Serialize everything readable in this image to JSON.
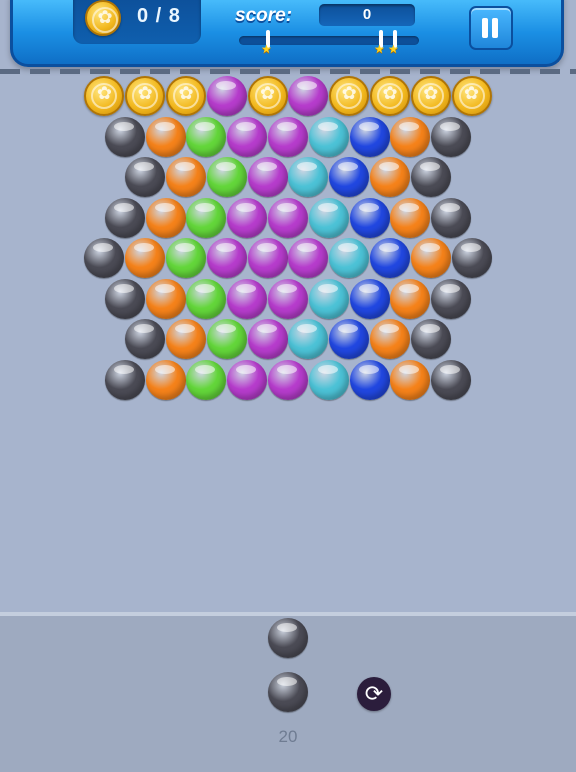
{
  "hud": {
    "coins_collected": "0 / 8",
    "score_label": "score:",
    "score_value": "0",
    "progress": 0,
    "star_markers": 3,
    "pause_icon": "pause-icon",
    "coin_icon": "gold-coin-icon"
  },
  "colors": {
    "G": "#4b4b55",
    "O": "#f5821a",
    "L": "#63d63a",
    "P": "#b63ccc",
    "C": "#4cc2d6",
    "B": "#2147e0",
    "Y": "coin"
  },
  "board": {
    "rows": [
      [
        "Y",
        "Y",
        "Y",
        "P",
        "Y",
        "P",
        "Y",
        "Y",
        "Y",
        "Y"
      ],
      [
        "G",
        "O",
        "L",
        "P",
        "P",
        "C",
        "B",
        "O",
        "G"
      ],
      [
        "G",
        "O",
        "L",
        "P",
        "C",
        "B",
        "O",
        "G"
      ],
      [
        "G",
        "O",
        "L",
        "P",
        "P",
        "C",
        "B",
        "O",
        "G"
      ],
      [
        "G",
        "O",
        "L",
        "P",
        "P",
        "P",
        "C",
        "B",
        "O",
        "G"
      ],
      [
        "G",
        "O",
        "L",
        "P",
        "P",
        "C",
        "B",
        "O",
        "G"
      ],
      [
        "G",
        "O",
        "L",
        "P",
        "C",
        "B",
        "O",
        "G"
      ],
      [
        "G",
        "O",
        "L",
        "P",
        "P",
        "C",
        "B",
        "O",
        "G"
      ]
    ]
  },
  "shooter": {
    "next_bubble": "G",
    "current_bubble": "G",
    "shots_left": "20",
    "swap_icon": "refresh-icon"
  }
}
